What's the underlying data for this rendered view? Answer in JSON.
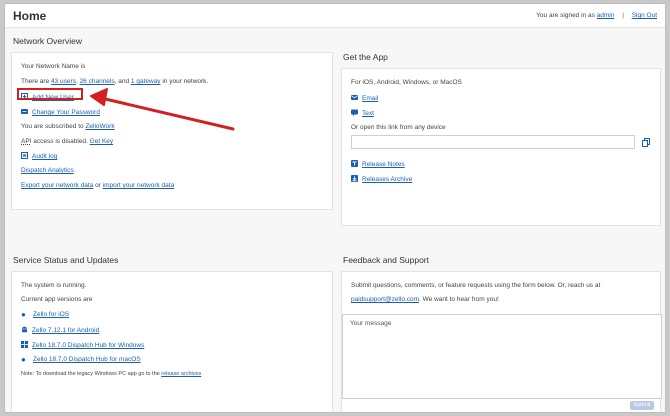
{
  "header": {
    "title": "Home",
    "signed_in_prefix": "You are signed in as",
    "username": "admin",
    "separator": "|",
    "sign_out": "Sign Out"
  },
  "network_overview": {
    "title": "Network Overview",
    "network_name_label": "Your Network Name is",
    "stats_prefix": "There are",
    "users": "43 users",
    "comma1": ",",
    "channels": "26 channels",
    "and": ", and",
    "gateways": "1 gateway",
    "stats_suffix": "in your network.",
    "add_user": "Add New User",
    "change_password": "Change Your Password",
    "subscribed_prefix": "You are subscribed to",
    "plan": "ZelloWork",
    "api_prefix": "API",
    "api_text": "access is disabled.",
    "get_key": "Get Key",
    "audit_log": "Audit log",
    "dispatch_analytics": "Dispatch Analytics",
    "export_data": "Export your network data",
    "or": "or",
    "import_data": "import your network data"
  },
  "get_app": {
    "title": "Get the App",
    "platforms": "For iOS, Android, Windows, or MacOS",
    "email": "Email",
    "text": "Text",
    "open_link": "Or open this link from any device",
    "link_value": "",
    "release_notes": "Release Notes",
    "releases_archive": "Releases Archive"
  },
  "service_status": {
    "title": "Service Status and Updates",
    "running": "The system is running.",
    "versions_label": "Current app versions are",
    "ios": "Zello for iOS",
    "android": "Zello 7.12.1 for Android",
    "windows": "Zello 18.7.0 Dispatch Hub for Windows",
    "macos": "Zello 18.7.0 Dispatch Hub for macOS",
    "note_prefix": "Note: To download the legacy Windows PC app go to the",
    "release_archives": "release archives"
  },
  "feedback": {
    "title": "Feedback and Support",
    "intro": "Submit questions, comments, or feature requests using the form below. Or, reach us at",
    "support_email": "paidsupport@zello.com",
    "intro_suffix": ". We want to hear from you!",
    "message_placeholder": "Your message",
    "submit": "Submit"
  },
  "colors": {
    "link": "#1a5fb4",
    "annotation": "#d21f1f"
  }
}
